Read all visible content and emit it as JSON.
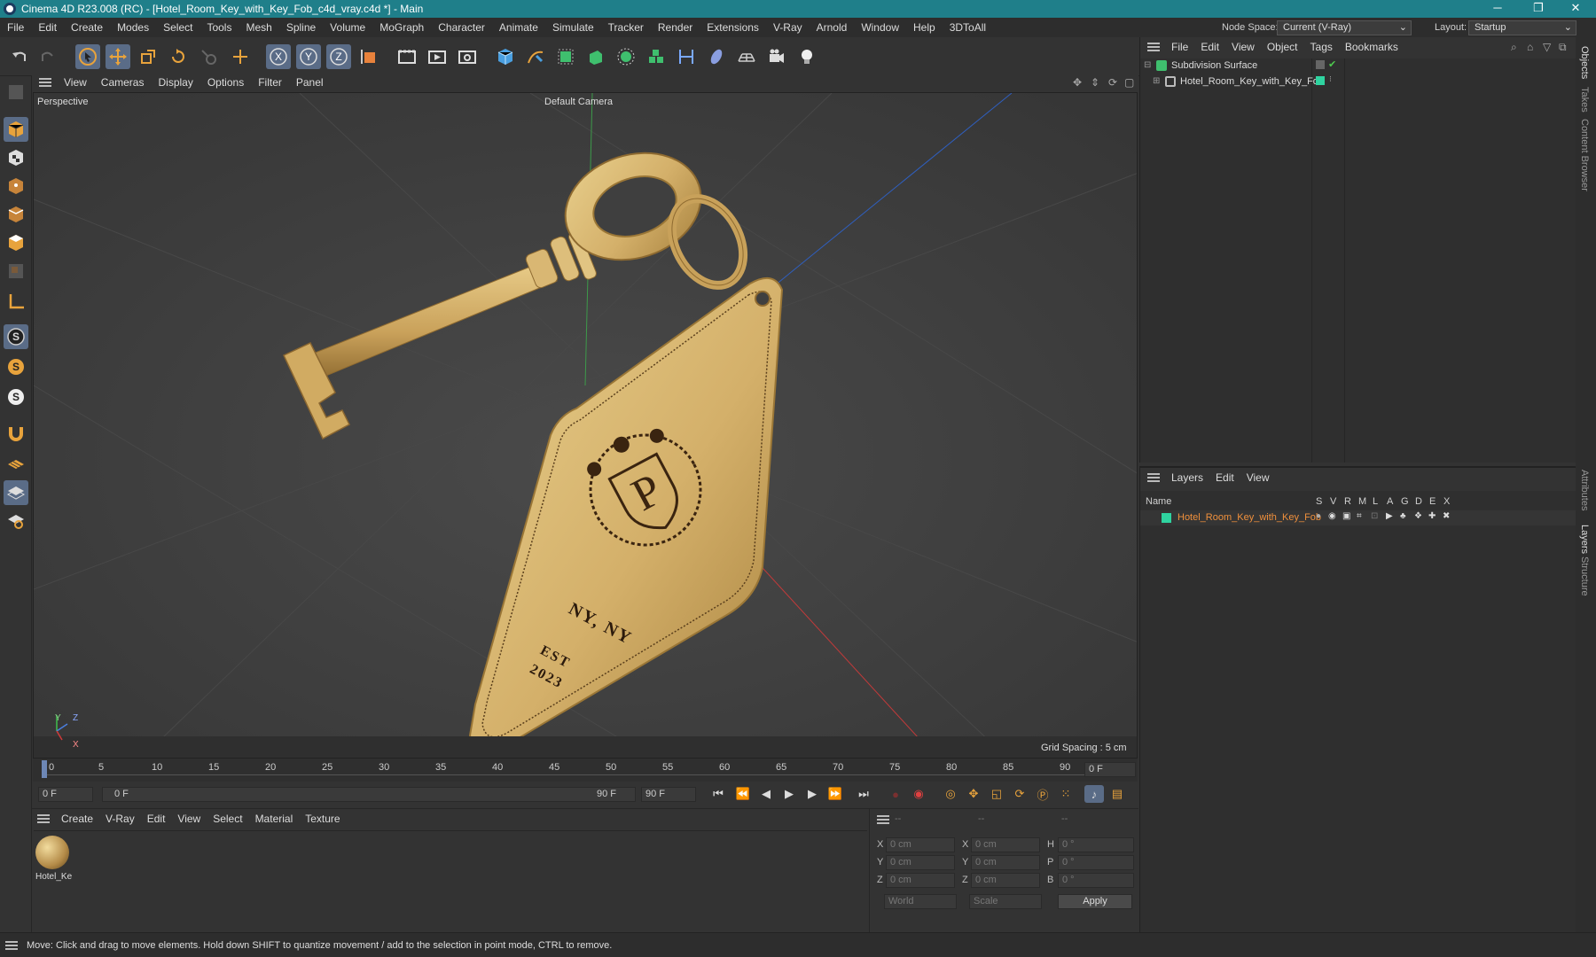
{
  "window": {
    "title": "Cinema 4D R23.008 (RC) - [Hotel_Room_Key_with_Key_Fob_c4d_vray.c4d *] - Main",
    "minimize": "─",
    "restore": "❐",
    "close": "✕"
  },
  "menubar": {
    "items": [
      "File",
      "Edit",
      "Create",
      "Modes",
      "Select",
      "Tools",
      "Mesh",
      "Spline",
      "Volume",
      "MoGraph",
      "Character",
      "Animate",
      "Simulate",
      "Tracker",
      "Render",
      "Extensions",
      "V-Ray",
      "Arnold",
      "Window",
      "Help",
      "3DToAll"
    ],
    "node_space_label": "Node Space:",
    "node_space_value": "Current (V-Ray)",
    "layout_label": "Layout:",
    "layout_value": "Startup"
  },
  "viewport": {
    "menu": [
      "View",
      "Cameras",
      "Display",
      "Options",
      "Filter",
      "Panel"
    ],
    "view_name": "Perspective",
    "camera": "Default Camera",
    "grid_spacing": "Grid Spacing : 5 cm",
    "fob_text_1": "NY, NY",
    "fob_text_2": "EST",
    "fob_text_3": "2023",
    "axis_y": "Y",
    "axis_z": "Z",
    "axis_x": "X"
  },
  "timeline": {
    "ticks": [
      "0",
      "5",
      "10",
      "15",
      "20",
      "25",
      "30",
      "35",
      "40",
      "45",
      "50",
      "55",
      "60",
      "65",
      "70",
      "75",
      "80",
      "85",
      "90"
    ],
    "current_frame": "0 F"
  },
  "playback": {
    "start": "0 F",
    "range_start": "0 F",
    "range_end": "90 F",
    "end": "90 F"
  },
  "materials": {
    "menu": [
      "Create",
      "V-Ray",
      "Edit",
      "View",
      "Select",
      "Material",
      "Texture"
    ],
    "items": [
      {
        "name": "Hotel_Ke"
      }
    ]
  },
  "coords": {
    "headers": [
      "--",
      "--",
      "--"
    ],
    "rows": [
      {
        "a": "X",
        "av": "0 cm",
        "b": "X",
        "bv": "0 cm",
        "c": "H",
        "cv": "0 °"
      },
      {
        "a": "Y",
        "av": "0 cm",
        "b": "Y",
        "bv": "0 cm",
        "c": "P",
        "cv": "0 °"
      },
      {
        "a": "Z",
        "av": "0 cm",
        "b": "Z",
        "bv": "0 cm",
        "c": "B",
        "cv": "0 °"
      }
    ],
    "space": "World",
    "mode": "Scale",
    "apply": "Apply"
  },
  "objects": {
    "menu": [
      "File",
      "Edit",
      "View",
      "Object",
      "Tags",
      "Bookmarks"
    ],
    "tree": [
      {
        "name": "Subdivision Surface"
      },
      {
        "name": "Hotel_Room_Key_with_Key_Fob"
      }
    ]
  },
  "layers": {
    "menu": [
      "Layers",
      "Edit",
      "View"
    ],
    "name_header": "Name",
    "flag_headers": [
      "S",
      "V",
      "R",
      "M",
      "L",
      "A",
      "G",
      "D",
      "E",
      "X"
    ],
    "items": [
      {
        "name": "Hotel_Room_Key_with_Key_Fob",
        "color": "#2fd3a0"
      }
    ]
  },
  "right_tabs": [
    "Objects",
    "Takes",
    "Content Browser",
    "Attributes",
    "Layers",
    "Structure"
  ],
  "status": "Move: Click and drag to move elements. Hold down SHIFT to quantize movement / add to the selection in point mode, CTRL to remove.",
  "colors": {
    "accent": "#5a6c87",
    "title_bar": "#1f7f8a",
    "layer_name": "#f0903c",
    "key_gold": "#d9b871"
  }
}
